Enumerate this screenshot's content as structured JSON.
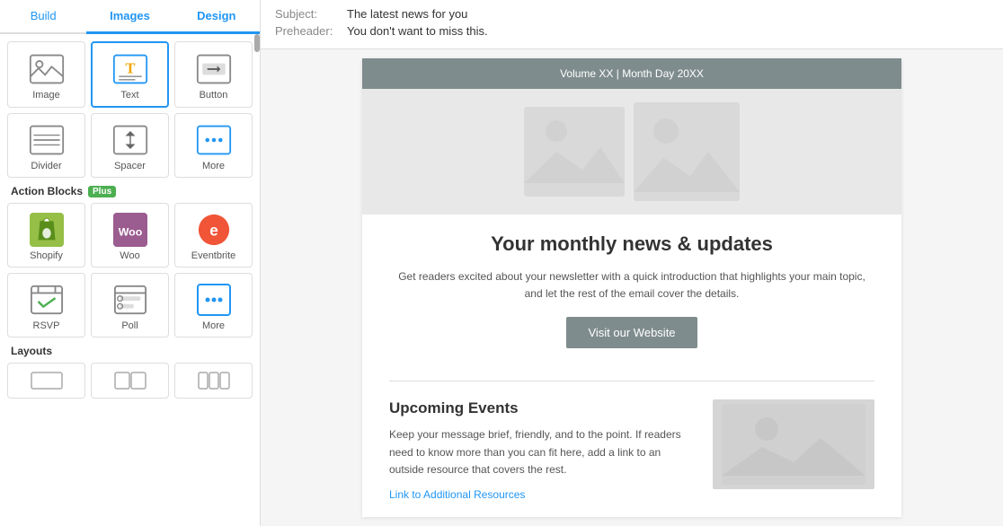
{
  "tabs": {
    "items": [
      {
        "label": "Build",
        "active": false
      },
      {
        "label": "Images",
        "active": true
      },
      {
        "label": "Design",
        "active": true
      }
    ]
  },
  "content_blocks": {
    "items": [
      {
        "id": "image",
        "label": "Image"
      },
      {
        "id": "text",
        "label": "Text"
      },
      {
        "id": "button",
        "label": "Button"
      },
      {
        "id": "divider",
        "label": "Divider"
      },
      {
        "id": "spacer",
        "label": "Spacer"
      },
      {
        "id": "more",
        "label": "More"
      }
    ]
  },
  "action_blocks": {
    "title": "Action Blocks",
    "badge": "Plus",
    "items": [
      {
        "id": "shopify",
        "label": "Shopify"
      },
      {
        "id": "woo",
        "label": "Woo"
      },
      {
        "id": "eventbrite",
        "label": "Eventbrite"
      },
      {
        "id": "rsvp",
        "label": "RSVP"
      },
      {
        "id": "poll",
        "label": "Poll"
      },
      {
        "id": "more-action",
        "label": "More"
      }
    ]
  },
  "layouts": {
    "title": "Layouts"
  },
  "email": {
    "subject_label": "Subject:",
    "subject_value": "The latest news for you",
    "preheader_label": "Preheader:",
    "preheader_value": "You don't want to miss this.",
    "topbar_text": "Volume XX | Month Day 20XX",
    "headline": "Your monthly news & updates",
    "body_text": "Get readers excited about your newsletter with a quick introduction that highlights your main topic, and let the rest of the email cover the details.",
    "cta_button": "Visit our Website",
    "events_title": "Upcoming Events",
    "events_text": "Keep your message brief, friendly, and to the point. If readers need to know more than you can fit here, add a link to an outside resource that covers the rest.",
    "events_link": "Link to Additional Resources"
  }
}
